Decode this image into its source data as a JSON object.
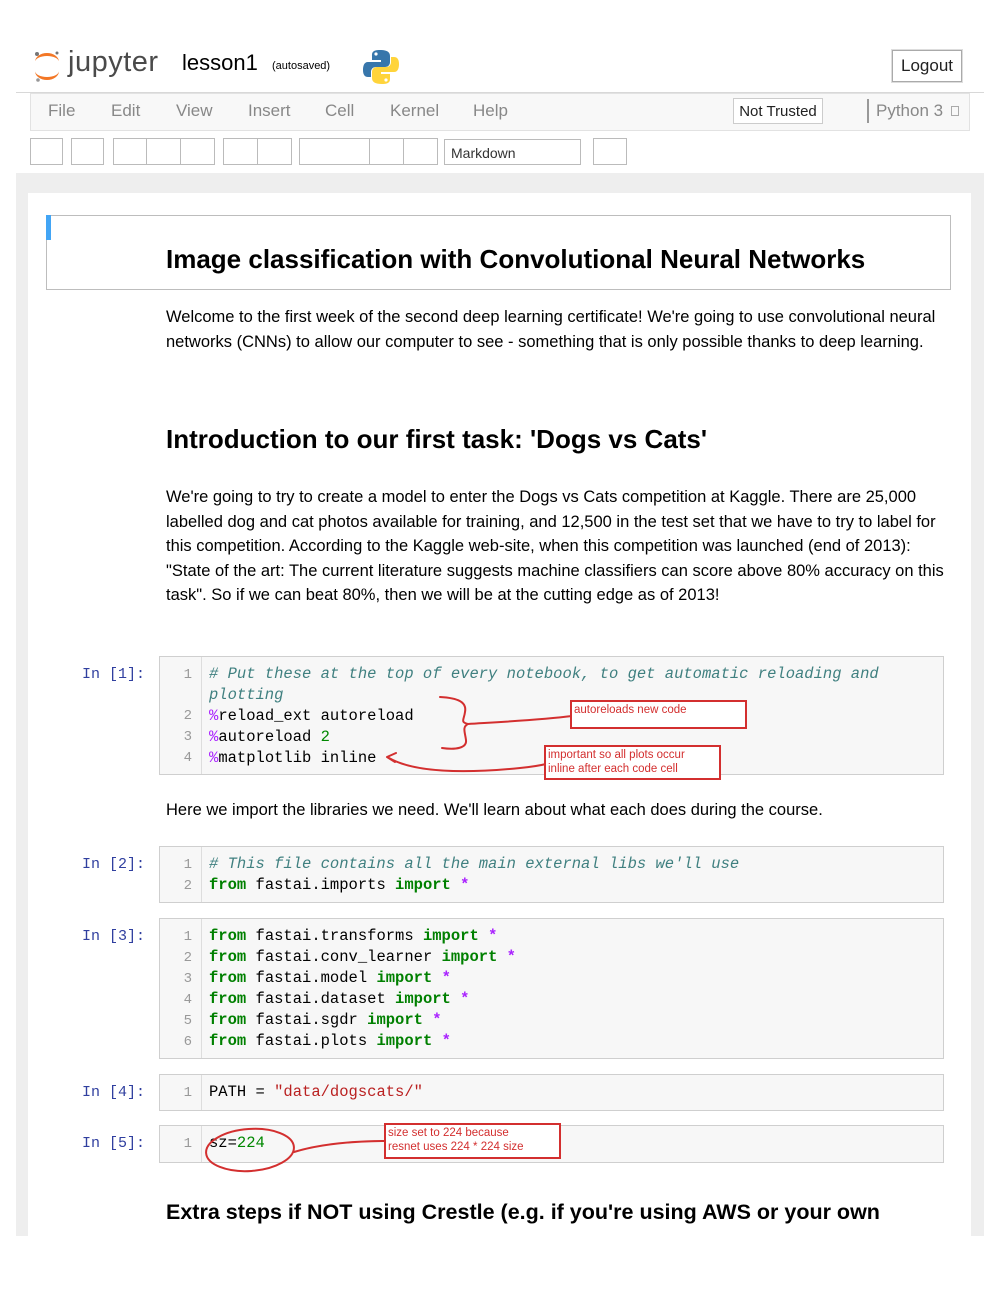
{
  "header": {
    "logo_text": "jupyter",
    "notebook_name": "lesson1",
    "autosave_status": "(autosaved)",
    "logout_label": "Logout"
  },
  "menu": {
    "items": [
      "File",
      "Edit",
      "View",
      "Insert",
      "Cell",
      "Kernel",
      "Help"
    ],
    "trust_status": "Not Trusted",
    "kernel_name": "Python 3"
  },
  "toolbar": {
    "cell_type": "Markdown"
  },
  "notebook": {
    "title": "Image classification with Convolutional Neural Networks",
    "intro_paragraph": "Welcome to the first week of the second deep learning certificate! We're going to use convolutional neural networks (CNNs) to allow our computer to see - something that is only possible thanks to deep learning.",
    "section_heading": "Introduction to our first task: 'Dogs vs Cats'",
    "task_paragraph": "We're going to try to create a model to enter the Dogs vs Cats competition at Kaggle. There are 25,000 labelled dog and cat photos available for training, and 12,500 in the test set that we have to try to label for this competition. According to the Kaggle web-site, when this competition was launched (end of 2013): \"State of the art: The current literature suggests machine classifiers can score above 80% accuracy on this task\". So if we can beat 80%, then we will be at the cutting edge as of 2013!",
    "imports_paragraph": "Here we import the libraries we need. We'll learn about what each does during the course.",
    "extra_heading": "Extra steps if NOT using Crestle (e.g. if you're using AWS or your own",
    "cells": {
      "c1": {
        "prompt": "In [1]:",
        "comment_line1": "# Put these at the top of every notebook, to get automatic reloading and",
        "comment_line2": "plotting",
        "l2_magic": "%",
        "l2_text": "reload_ext autoreload",
        "l3_magic": "%",
        "l3_text": "autoreload ",
        "l3_num": "2",
        "l4_magic": "%",
        "l4_text": "matplotlib inline"
      },
      "c2": {
        "prompt": "In [2]:",
        "comment": "# This file contains all the main external libs we'll use",
        "kw_from": "from",
        "module": " fastai.imports ",
        "kw_import": "import",
        "star": " *"
      },
      "c3": {
        "prompt": "In [3]:",
        "kw_from": "from",
        "kw_import": "import",
        "star": " *",
        "modules": [
          " fastai.transforms ",
          " fastai.conv_learner ",
          " fastai.model ",
          " fastai.dataset ",
          " fastai.sgdr ",
          " fastai.plots "
        ]
      },
      "c4": {
        "prompt": "In [4]:",
        "var": "PATH = ",
        "str": "\"data/dogscats/\""
      },
      "c5": {
        "prompt": "In [5]:",
        "var": "sz=",
        "num": "224"
      }
    },
    "line_numbers": [
      "1",
      "2",
      "3",
      "4",
      "5",
      "6"
    ]
  },
  "annotations": {
    "autoreload": "autoreloads new code",
    "inline_line1": "important so all plots occur",
    "inline_line2": "inline after each code cell",
    "size_line1": "size set to 224 because",
    "size_line2": "resnet uses 224 * 224 size"
  },
  "colors": {
    "annotation": "#d32f2f",
    "prompt": "#303f9f",
    "keyword": "#008000",
    "comment": "#408080",
    "string": "#ba2121",
    "cell_marker": "#42a5f5"
  }
}
